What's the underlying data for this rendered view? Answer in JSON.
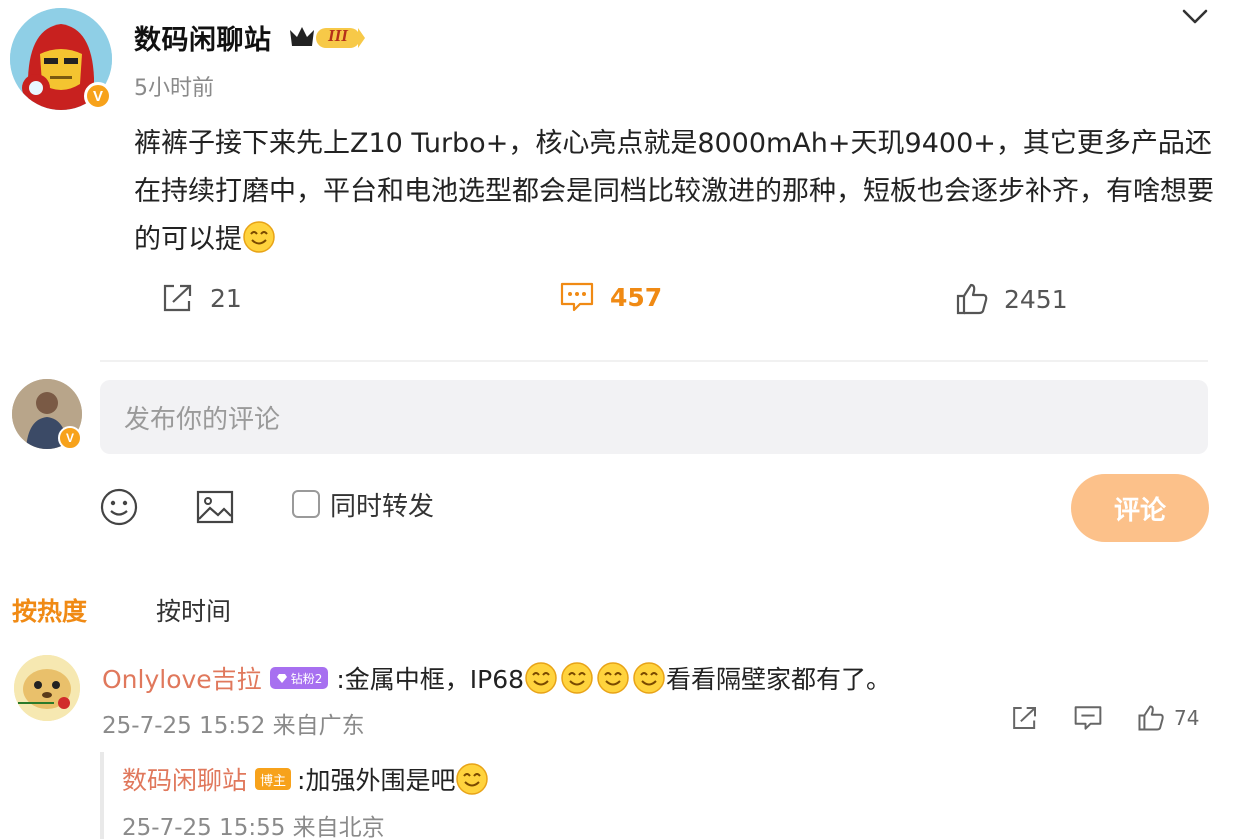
{
  "post": {
    "author": "数码闲聊站",
    "level_badge": "III",
    "time": "5小时前",
    "body": "裤裤子接下来先上Z10 Turbo+，核心亮点就是8000mAh+天玑9400+，其它更多产品还在持续打磨中，平台和电池选型都会是同档比较激进的那种，短板也会逐步补齐，有啥想要的可以提",
    "verified_mark": "V",
    "actions": {
      "share_count": "21",
      "comment_count": "457",
      "like_count": "2451"
    }
  },
  "composer": {
    "placeholder": "发布你的评论",
    "repost_label": "同时转发",
    "submit_label": "评论",
    "verified_mark": "V"
  },
  "sort_tabs": {
    "hot": "按热度",
    "time": "按时间"
  },
  "comments": [
    {
      "user": "Onlylove吉拉",
      "badge": "钻粉2",
      "text_prefix": ":金属中框，IP68",
      "text_suffix": "看看隔壁家都有了。",
      "meta": "25-7-25 15:52 来自广东",
      "like_count": "74",
      "reply": {
        "user": "数码闲聊站",
        "badge": "博主",
        "text": ":加强外围是吧",
        "meta": "25-7-25 15:55 来自北京"
      }
    }
  ],
  "colors": {
    "accent": "#f08a14",
    "username": "#e0785c",
    "submit_disabled": "#fcc18a",
    "verified": "#f7a21b",
    "fan_badge": "#a770f0"
  },
  "icons": {
    "share": "share-icon",
    "comment": "comment-icon",
    "like": "thumbs-up-icon",
    "emoji": "smile-emoji",
    "menu": "chevron-down-icon"
  }
}
